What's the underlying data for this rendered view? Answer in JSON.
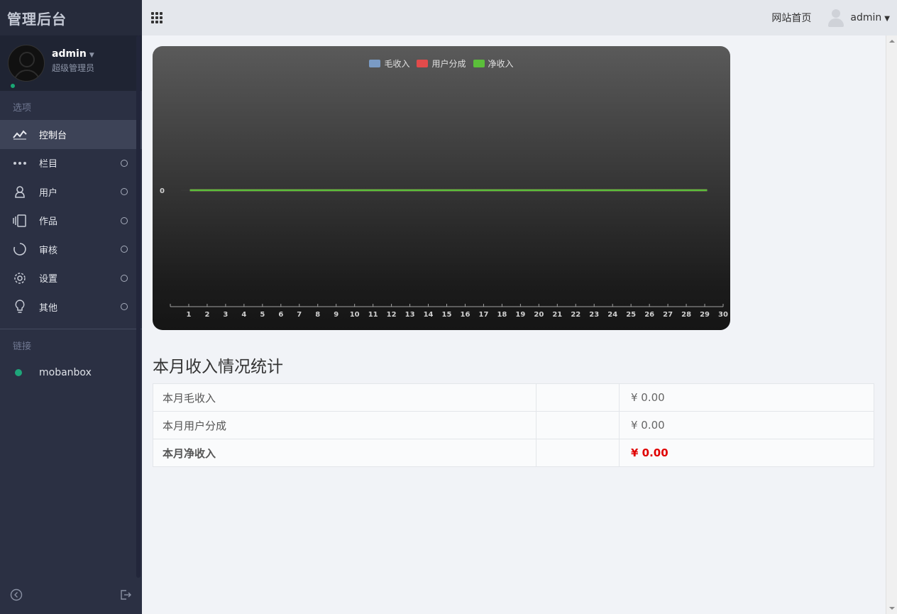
{
  "brand": {
    "title": "管理后台"
  },
  "user": {
    "name": "admin",
    "role": "超级管理员",
    "online_color": "#19a774"
  },
  "sidebar": {
    "section_options": "选项",
    "items": [
      {
        "label": "控制台",
        "icon": "line-chart-icon",
        "active": true
      },
      {
        "label": "栏目",
        "icon": "more-dots-icon"
      },
      {
        "label": "用户",
        "icon": "user-icon"
      },
      {
        "label": "作品",
        "icon": "copy-icon"
      },
      {
        "label": "审核",
        "icon": "loading-circle-icon"
      },
      {
        "label": "设置",
        "icon": "gear-icon"
      },
      {
        "label": "其他",
        "icon": "bulb-icon"
      }
    ],
    "section_links": "链接",
    "links": [
      {
        "label": "mobanbox",
        "dot_color": "#1ea67a"
      }
    ]
  },
  "topbar": {
    "home_label": "网站首页",
    "user_label": "admin"
  },
  "chart_data": {
    "type": "line",
    "x": [
      "1",
      "2",
      "3",
      "4",
      "5",
      "6",
      "7",
      "8",
      "9",
      "10",
      "11",
      "12",
      "13",
      "14",
      "15",
      "16",
      "17",
      "18",
      "19",
      "20",
      "21",
      "22",
      "23",
      "24",
      "25",
      "26",
      "27",
      "28",
      "29",
      "30"
    ],
    "series": [
      {
        "name": "毛收入",
        "color": "#7a9bc5",
        "values": [
          0,
          0,
          0,
          0,
          0,
          0,
          0,
          0,
          0,
          0,
          0,
          0,
          0,
          0,
          0,
          0,
          0,
          0,
          0,
          0,
          0,
          0,
          0,
          0,
          0,
          0,
          0,
          0,
          0,
          0
        ]
      },
      {
        "name": "用户分成",
        "color": "#e24b4b",
        "values": [
          0,
          0,
          0,
          0,
          0,
          0,
          0,
          0,
          0,
          0,
          0,
          0,
          0,
          0,
          0,
          0,
          0,
          0,
          0,
          0,
          0,
          0,
          0,
          0,
          0,
          0,
          0,
          0,
          0,
          0
        ]
      },
      {
        "name": "净收入",
        "color": "#5bbf3a",
        "values": [
          0,
          0,
          0,
          0,
          0,
          0,
          0,
          0,
          0,
          0,
          0,
          0,
          0,
          0,
          0,
          0,
          0,
          0,
          0,
          0,
          0,
          0,
          0,
          0,
          0,
          0,
          0,
          0,
          0,
          0
        ]
      }
    ],
    "y_ticks": [
      "0"
    ],
    "legend": "top-center",
    "grid": false
  },
  "stats": {
    "title": "本月收入情况统计",
    "rows": [
      {
        "label": "本月毛收入",
        "middle": "",
        "value": "¥ 0.00"
      },
      {
        "label": "本月用户分成",
        "middle": "",
        "value": "¥ 0.00"
      },
      {
        "label": "本月净收入",
        "middle": "",
        "value": "¥ 0.00"
      }
    ]
  }
}
